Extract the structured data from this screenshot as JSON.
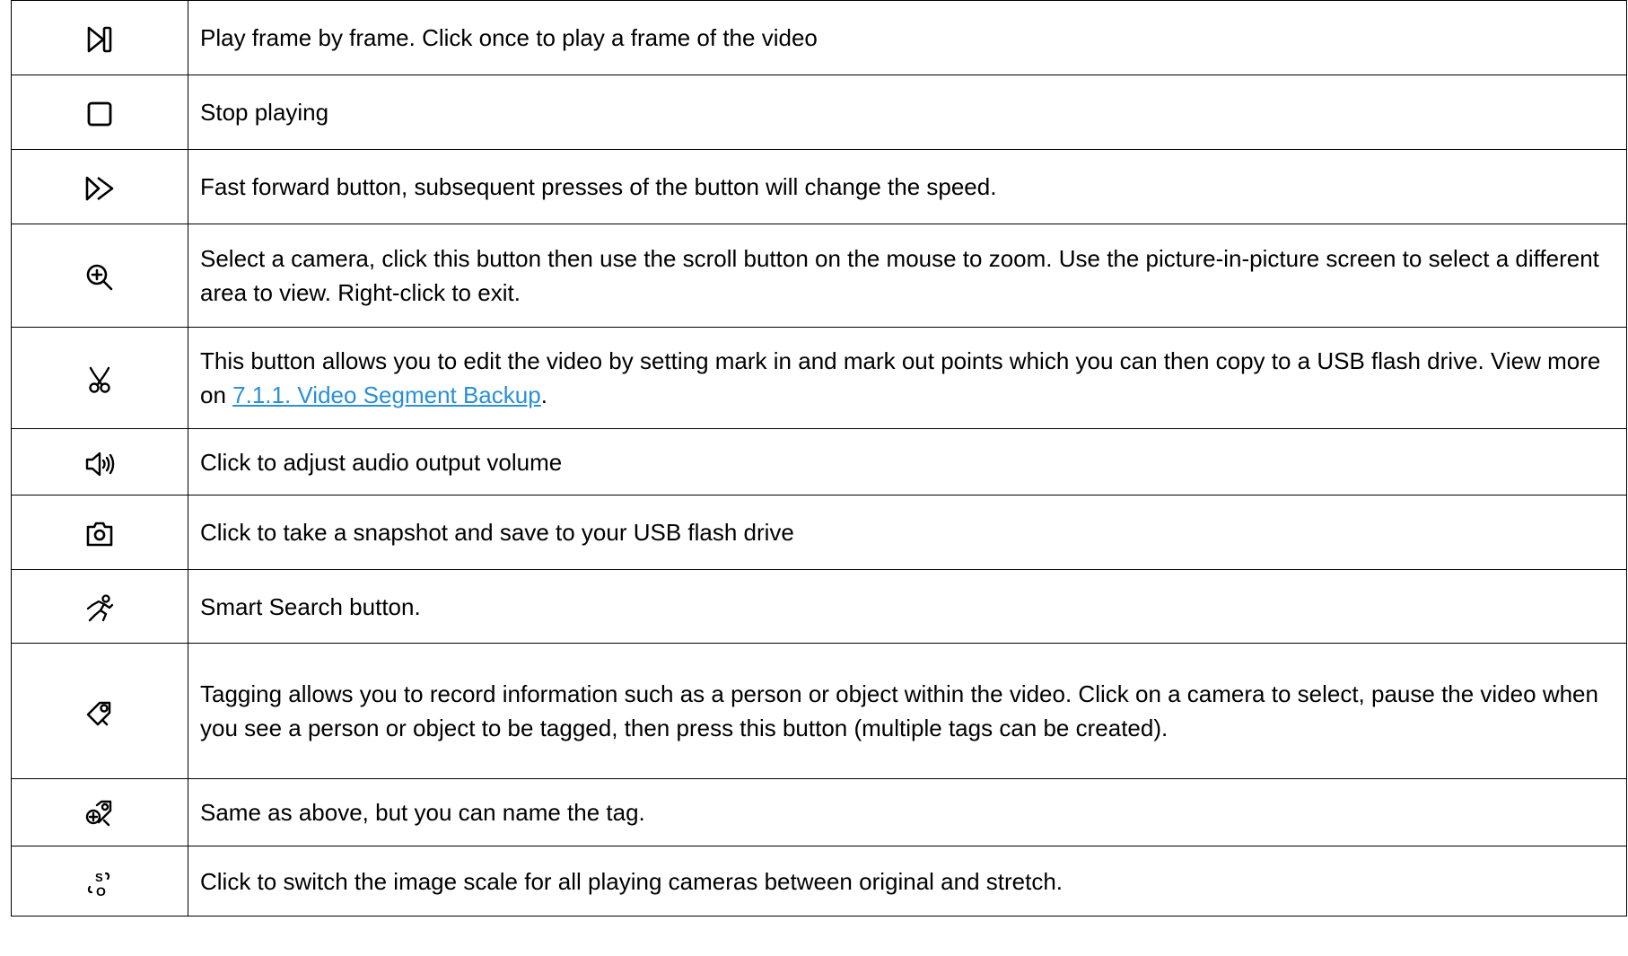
{
  "rows": [
    {
      "icon": "frame-step-icon",
      "text": "Play frame by frame. Click once to play a frame of the video"
    },
    {
      "icon": "stop-icon",
      "text": "Stop playing"
    },
    {
      "icon": "fast-forward-icon",
      "text": "Fast forward button, subsequent presses of the button will change the speed."
    },
    {
      "icon": "zoom-in-icon",
      "text": "Select a camera, click this button then use the scroll button on the mouse to zoom. Use the picture-in-picture screen to select a different area to view. Right-click to exit."
    },
    {
      "icon": "scissors-icon",
      "text_before": "This button allows you to edit the video by setting mark in and mark out points which you can then copy to a USB flash drive. View more on ",
      "link": "7.1.1. Video Segment Backup",
      "text_after": "."
    },
    {
      "icon": "speaker-icon",
      "text": "Click to adjust audio output volume"
    },
    {
      "icon": "camera-icon",
      "text": "Click to take a snapshot and save to your USB flash drive"
    },
    {
      "icon": "running-person-icon",
      "text": "Smart Search button."
    },
    {
      "icon": "tag-icon",
      "text": "Tagging allows you to record information such as a person or object within the video. Click on a camera to select, pause the video when you see a person or object to be tagged, then press this button (multiple tags can be created)."
    },
    {
      "icon": "tag-add-icon",
      "text": "Same as above, but you can name the tag."
    },
    {
      "icon": "scale-switch-icon",
      "text": "Click to switch the image scale for all playing cameras between original and stretch."
    }
  ],
  "colors": {
    "link": "#2a8fd6",
    "border": "#000000"
  }
}
